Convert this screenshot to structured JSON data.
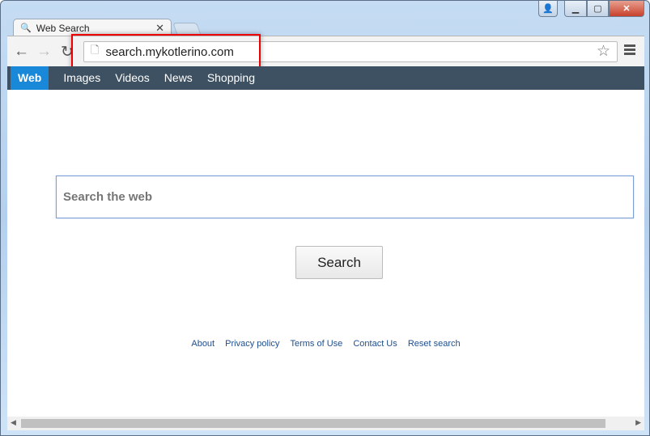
{
  "window": {
    "controls": [
      "user",
      "minimize",
      "maximize",
      "close"
    ]
  },
  "tab": {
    "title": "Web Search",
    "icon": "search-icon"
  },
  "toolbar": {
    "url": "search.mykotlerino.com"
  },
  "nav": {
    "items": [
      {
        "label": "Web",
        "active": true
      },
      {
        "label": "Images"
      },
      {
        "label": "Videos"
      },
      {
        "label": "News"
      },
      {
        "label": "Shopping"
      }
    ]
  },
  "search": {
    "placeholder": "Search the web",
    "button": "Search"
  },
  "footer": {
    "links": [
      "About",
      "Privacy policy",
      "Terms of Use",
      "Contact Us",
      "Reset search"
    ]
  },
  "colors": {
    "nav_bg": "#3e5162",
    "active": "#1a88d8",
    "highlight": "#ee0000"
  }
}
